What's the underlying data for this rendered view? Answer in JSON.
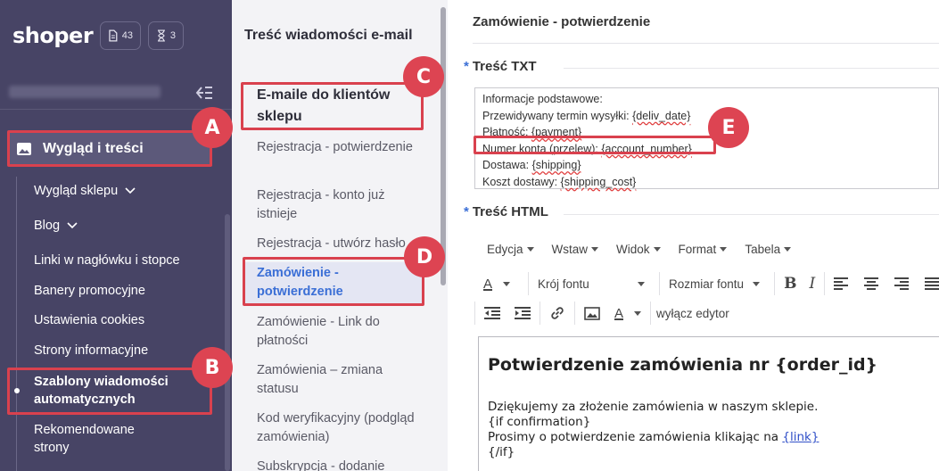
{
  "brand": {
    "logo": "shoper"
  },
  "badges": {
    "pages_count": "43",
    "pending_count": "3"
  },
  "sidebar": {
    "main_section": "Wygląd i treści",
    "items": [
      {
        "label": "Wygląd sklepu",
        "has_chevron": true
      },
      {
        "label": "Blog",
        "has_chevron": true
      },
      {
        "label": "Linki w nagłówku i stopce"
      },
      {
        "label": "Banery promocyjne"
      },
      {
        "label": "Ustawienia cookies"
      },
      {
        "label": "Strony informacyjne"
      },
      {
        "label": "Szablony wiadomości automatycznych",
        "active": true
      },
      {
        "label": "Rekomendowane strony"
      }
    ]
  },
  "midlist": {
    "title": "Treść wiadomości e-mail",
    "group": "E-maile do klientów sklepu",
    "items": [
      "Rejestracja - potwierdzenie",
      "Rejestracja - konto już istnieje",
      "Rejestracja - utwórz hasło",
      "Zamówienie - potwierdzenie",
      "Zamówienie - Link do płatności",
      "Zamówienia – zmiana statusu",
      "Kod weryfikacyjny (podgląd zamówienia)",
      "Subskrypcja - dodanie"
    ],
    "active_index": 3
  },
  "main": {
    "page_title": "Zamówienie - potwierdzenie",
    "txt_label": "Treść TXT",
    "txt_lines": [
      {
        "text": "Informacje podstawowe:"
      },
      {
        "text": "Przewidywany termin wysyłki: ",
        "var": "{deliv_date}"
      },
      {
        "text": "Płatność: ",
        "var": "{payment}"
      },
      {
        "text": "Numer konta (przelew): ",
        "var": "{account_number}"
      },
      {
        "text": "Dostawa: ",
        "var": "{shipping}"
      },
      {
        "text": "Koszt dostawy: ",
        "var": "{shipping_cost}"
      }
    ],
    "html_label": "Treść HTML",
    "menubar": [
      "Edycja",
      "Wstaw",
      "Widok",
      "Format",
      "Tabela"
    ],
    "toolbar": {
      "font_family": "Krój fontu",
      "font_size": "Rozmiar fontu",
      "disable_editor": "wyłącz edytor",
      "text_color_glyph": "A",
      "bold_glyph": "B",
      "italic_glyph": "I"
    },
    "editor": {
      "heading": "Potwierdzenie zamówienia nr {order_id}",
      "line1": "Dziękujemy za złożenie zamówienia w naszym sklepie.",
      "line2": "{if confirmation}",
      "line3_text": "Prosimy o potwierdzenie zamówienia klikając na ",
      "line3_link": "{link}",
      "line4": "{/if}"
    }
  },
  "callouts": {
    "a": "A",
    "b": "B",
    "c": "C",
    "d": "D",
    "e": "E"
  },
  "colors": {
    "sidebar_bg": "#474465",
    "accent": "#3b6fd6",
    "callout": "#dd4452"
  }
}
